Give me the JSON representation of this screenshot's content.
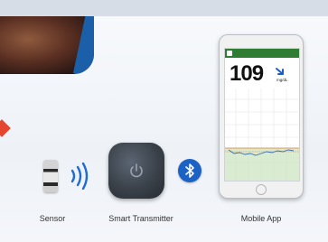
{
  "captions": {
    "sensor": "Sensor",
    "transmitter": "Smart Transmitter",
    "app": "Mobile App"
  },
  "app_screen": {
    "glucose_value": "109",
    "unit": "mg/dL"
  },
  "colors": {
    "bluetooth": "#1b62c4",
    "signal": "#1e6bd6",
    "app_header": "#2e7d32",
    "marker": "#e6462f"
  },
  "icons": {
    "signal": "nfc-signal-icon",
    "transmitter": "power-icon",
    "bluetooth": "bluetooth-icon"
  }
}
